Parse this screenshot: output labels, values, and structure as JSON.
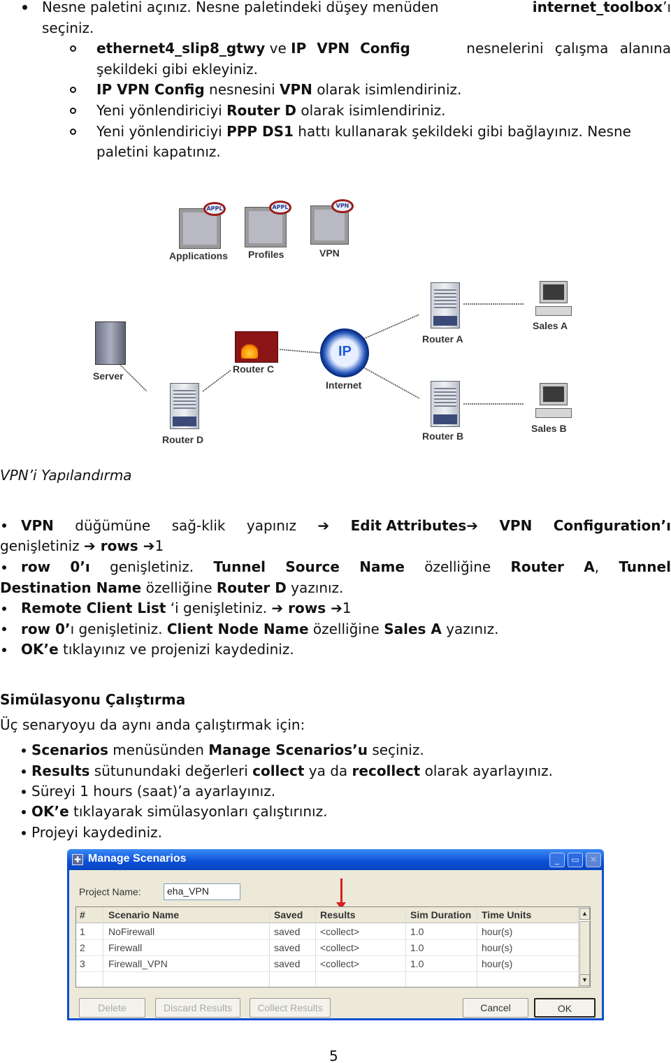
{
  "section1": {
    "main_bullet": {
      "parts": [
        "Nesne paletini açınız. Nesne paletindeki düşey menüden ",
        "internet_toolbox",
        "’ı"
      ],
      "line2": "seçiniz."
    },
    "sub_bullets": [
      {
        "bold1": "ethernet4_slip8_gtwy",
        "text1": " ve ",
        "bold2": "IP VPN Config",
        "text2": " nesnelerini çalışma alanına",
        "line2": "şekildeki gibi ekleyiniz."
      },
      {
        "bold1": "IP VPN Config",
        "text1": " nesnesini ",
        "bold2": "VPN",
        "text2": " olarak isimlendiriniz."
      },
      {
        "text0": "Yeni yönlendiriciyi ",
        "bold1": "Router D",
        "text1": " olarak isimlendiriniz."
      },
      {
        "text0": "Yeni yönlendiriciyi ",
        "bold1": "PPP DS1",
        "text1": " hattı kullanarak şekildeki gibi bağlayınız. Nesne",
        "line2": "paletini kapatınız."
      }
    ]
  },
  "diagram": {
    "palette": [
      {
        "label": "Applications",
        "badge": "APPL"
      },
      {
        "label": "Profiles",
        "badge": "APPL"
      },
      {
        "label": "VPN",
        "badge": "VPN"
      }
    ],
    "nodes": {
      "server": "Server",
      "router_c": "Router C",
      "router_d": "Router D",
      "internet": "Internet",
      "internet_badge": "IP",
      "router_a": "Router A",
      "router_b": "Router B",
      "sales_a": "Sales A",
      "sales_b": "Sales B"
    }
  },
  "section2": {
    "heading": "VPN’i Yapılandırma",
    "bullets": [
      {
        "l1": [
          "VPN",
          "düğümüne",
          "sağ-klik",
          "yapınız",
          "➔",
          "Edit",
          "Attributes",
          "➔",
          "VPN",
          "Configuration’ı"
        ],
        "l1_bold": [
          true,
          false,
          false,
          false,
          true,
          true,
          true,
          true,
          true,
          true
        ],
        "l2_text": "genişletiniz ",
        "l2_arrow": "➔",
        "l2_bold": " rows ",
        "l2_arrow2": "➔",
        "l2_end": "1"
      },
      {
        "l1": [
          "row",
          "0’ı",
          "genişletiniz.",
          "Tunnel",
          "Source",
          "Name",
          "özelliğine",
          "Router",
          "A",
          ",",
          "Tunnel"
        ],
        "l1_bold": [
          true,
          true,
          false,
          true,
          true,
          true,
          false,
          true,
          true,
          false,
          true
        ],
        "l2_b1": "Destination Name",
        "l2_t1": " özelliğine ",
        "l2_b2": "Router D",
        "l2_t2": " yazınız."
      },
      {
        "b1": "Remote Client List",
        "t1": " ‘i genişletiniz. ",
        "a1": "➔",
        "b2": " rows ",
        "a2": "➔",
        "t2": "1"
      },
      {
        "b1": "row 0’",
        "t1": "ı genişletiniz. ",
        "b2": "Client Node Name",
        "t2": " özelliğine ",
        "b3": "Sales A",
        "t3": " yazınız."
      },
      {
        "b1": "OK’e",
        "t1": " tıklayınız ve projenizi kaydediniz."
      }
    ]
  },
  "section3": {
    "heading": "Simülasyonu Çalıştırma",
    "intro": "Üç senaryoyu da aynı anda çalıştırmak için:",
    "bullets": [
      {
        "b1": "Scenarios",
        "t1": " menüsünden ",
        "b2": "Manage Scenarios’u",
        "t2": " seçiniz."
      },
      {
        "b1": "Results",
        "t1": " sütunundaki değerleri ",
        "b2": "collect",
        "t2": " ya da ",
        "b3": "recollect",
        "t3": " olarak ayarlayınız."
      },
      {
        "t1": "Süreyi 1 hours (saat)’a ayarlayınız."
      },
      {
        "b1": "OK’e",
        "t1": " tıklayarak simülasyonları çalıştırınız."
      },
      {
        "t1": "Projeyi kaydediniz."
      }
    ]
  },
  "dialog": {
    "title": "Manage Scenarios",
    "project_name_label": "Project Name:",
    "project_name_value": "eha_VPN",
    "columns": [
      "#",
      "Scenario Name",
      "Saved",
      "Results",
      "Sim Duration",
      "Time Units"
    ],
    "rows": [
      [
        "1",
        "NoFirewall",
        "saved",
        "<collect>",
        "1.0",
        "hour(s)"
      ],
      [
        "2",
        "Firewall",
        "saved",
        "<collect>",
        "1.0",
        "hour(s)"
      ],
      [
        "3",
        "Firewall_VPN",
        "saved",
        "<collect>",
        "1.0",
        "hour(s)"
      ]
    ],
    "buttons": {
      "delete": "Delete",
      "discard": "Discard Results",
      "collect": "Collect Results",
      "cancel": "Cancel",
      "ok": "OK"
    },
    "accent_color": "#0a4fd6",
    "arrow_color": "#d92020"
  },
  "page_number": "5"
}
